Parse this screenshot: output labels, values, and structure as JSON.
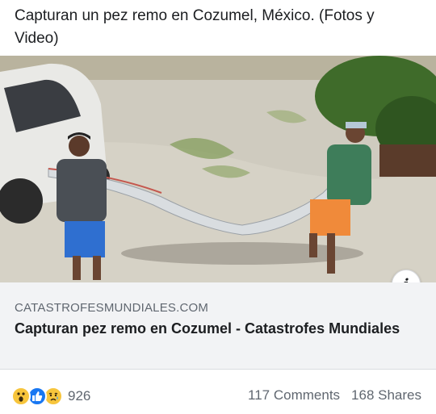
{
  "post": {
    "text": "Capturan un pez remo en Cozumel, México. (Fotos y Video)"
  },
  "link_preview": {
    "domain": "CATASTROFESMUNDIALES.COM",
    "title": "Capturan pez remo en Cozumel - Catastrofes Mundiales",
    "info_icon": "info-icon"
  },
  "footer": {
    "reaction_icons": [
      "wow-emoji",
      "like-thumb",
      "sad-emoji"
    ],
    "reaction_count": "926",
    "comments": "117 Comments",
    "shares": "168 Shares"
  },
  "colors": {
    "link_card_bg": "#f2f3f5",
    "muted_text": "#606770",
    "like_blue": "#1877f2",
    "emoji_yellow": "#f7c53c"
  }
}
